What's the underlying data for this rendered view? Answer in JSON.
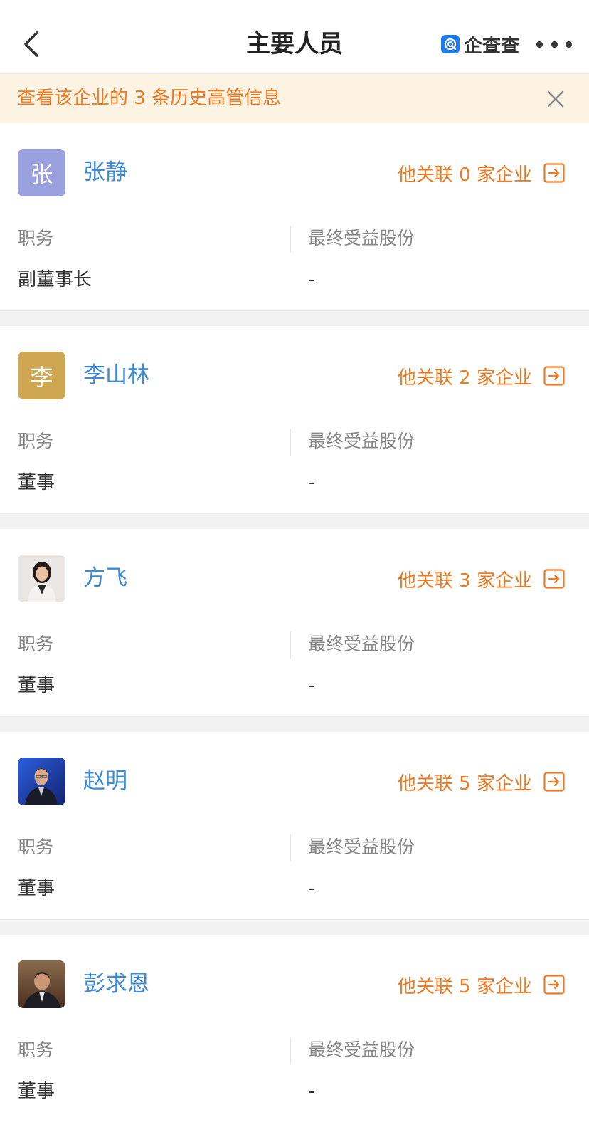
{
  "header": {
    "title": "主要人员",
    "brand": "企查查",
    "back_icon": "chevron-left-icon",
    "more_icon": "more-dots-icon"
  },
  "notice": {
    "text": "查看该企业的 3 条历史高管信息",
    "close_icon": "close-icon"
  },
  "labels": {
    "position": "职务",
    "beneficial_share": "最终受益股份"
  },
  "colors": {
    "name": "#3c8ad8",
    "accent": "#f07a22",
    "notice_bg": "#fdf3e3"
  },
  "people": [
    {
      "avatar_char": "张",
      "avatar_color": "#9aa0dd",
      "name": "张静",
      "assoc": "他关联 0 家企业",
      "position": "副董事长",
      "share": "-"
    },
    {
      "avatar_char": "李",
      "avatar_color": "#cfa752",
      "name": "李山林",
      "assoc": "他关联 2 家企业",
      "position": "董事",
      "share": "-"
    },
    {
      "avatar_char": "",
      "avatar_color": "#ffffff",
      "name": "方飞",
      "assoc": "他关联 3 家企业",
      "position": "董事",
      "share": "-"
    },
    {
      "avatar_char": "",
      "avatar_color": "#ffffff",
      "name": "赵明",
      "assoc": "他关联 5 家企业",
      "position": "董事",
      "share": "-"
    },
    {
      "avatar_char": "",
      "avatar_color": "#ffffff",
      "name": "彭求恩",
      "assoc": "他关联 5 家企业",
      "position": "董事",
      "share": "-"
    }
  ]
}
